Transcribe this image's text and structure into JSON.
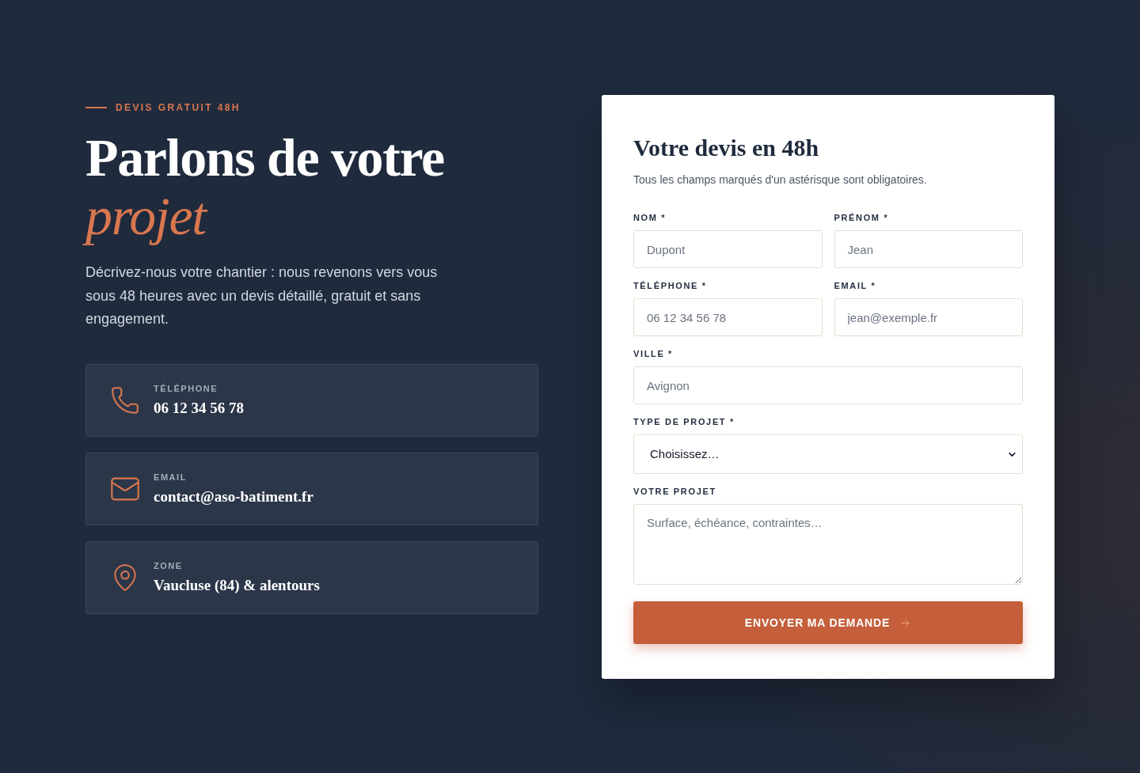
{
  "eyebrow": "DEVIS GRATUIT 48H",
  "heading": {
    "line": "Parlons de votre",
    "accent": "projet"
  },
  "intro": "Décrivez-nous votre chantier : nous revenons vers vous sous 48 heures avec un devis détaillé, gratuit et sans engagement.",
  "contacts": [
    {
      "kind": "phone",
      "label": "TÉLÉPHONE",
      "value": "06 12 34 56 78"
    },
    {
      "kind": "email",
      "label": "EMAIL",
      "value": "contact@aso-batiment.fr"
    },
    {
      "kind": "location",
      "label": "ZONE",
      "value": "Vaucluse (84) & alentours"
    }
  ],
  "form": {
    "title": "Votre devis en 48h",
    "note": "Tous les champs marqués d'un astérisque sont obligatoires.",
    "rows": [
      [
        {
          "kind": "text",
          "label": "NOM *",
          "placeholder": "Dupont"
        },
        {
          "kind": "text",
          "label": "PRÉNOM *",
          "placeholder": "Jean"
        }
      ],
      [
        {
          "kind": "text",
          "label": "TÉLÉPHONE *",
          "placeholder": "06 12 34 56 78"
        },
        {
          "kind": "text",
          "label": "EMAIL *",
          "placeholder": "jean@exemple.fr"
        }
      ],
      [
        {
          "kind": "text",
          "label": "VILLE *",
          "placeholder": "Avignon"
        }
      ],
      [
        {
          "kind": "select",
          "label": "TYPE DE PROJET *",
          "value": "Choisissez…"
        }
      ],
      [
        {
          "kind": "textarea",
          "label": "VOTRE PROJET",
          "placeholder": "Surface, échéance, contraintes…"
        }
      ]
    ],
    "submit": "ENVOYER MA DEMANDE"
  }
}
